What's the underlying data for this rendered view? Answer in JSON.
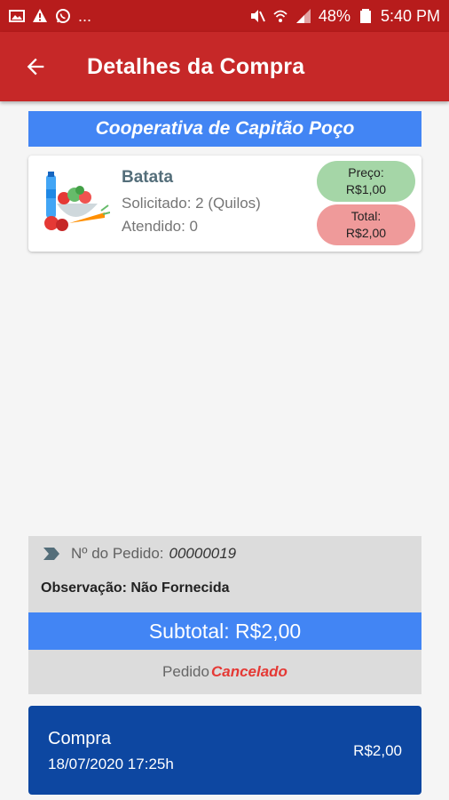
{
  "status_bar": {
    "dots": "...",
    "battery": "48%",
    "time": "5:40 PM"
  },
  "app_bar": {
    "title": "Detalhes da Compra"
  },
  "cooperative": {
    "name": "Cooperativa de Capitão Poço"
  },
  "product": {
    "name": "Batata",
    "requested": "Solicitado: 2 (Quilos)",
    "fulfilled": "Atendido: 0",
    "price_label": "Preço:",
    "price_value": "R$1,00",
    "total_label": "Total:",
    "total_value": "R$2,00"
  },
  "order": {
    "number_label": "Nº do Pedido:",
    "number_value": "00000019",
    "observation": "Observação: Não Fornecida",
    "subtotal": "Subtotal: R$2,00",
    "status_label": "Pedido",
    "status_value": "Cancelado"
  },
  "purchase": {
    "title": "Compra",
    "date": "18/07/2020 17:25h",
    "amount": "R$2,00"
  },
  "colors": {
    "status_bar": "#b71c1c",
    "app_bar": "#c62828",
    "accent_blue": "#4285f4",
    "purchase_card": "#0d47a1",
    "price_pill": "#a5d6a7",
    "total_pill": "#ef9a9a",
    "cancel_red": "#e53935"
  }
}
